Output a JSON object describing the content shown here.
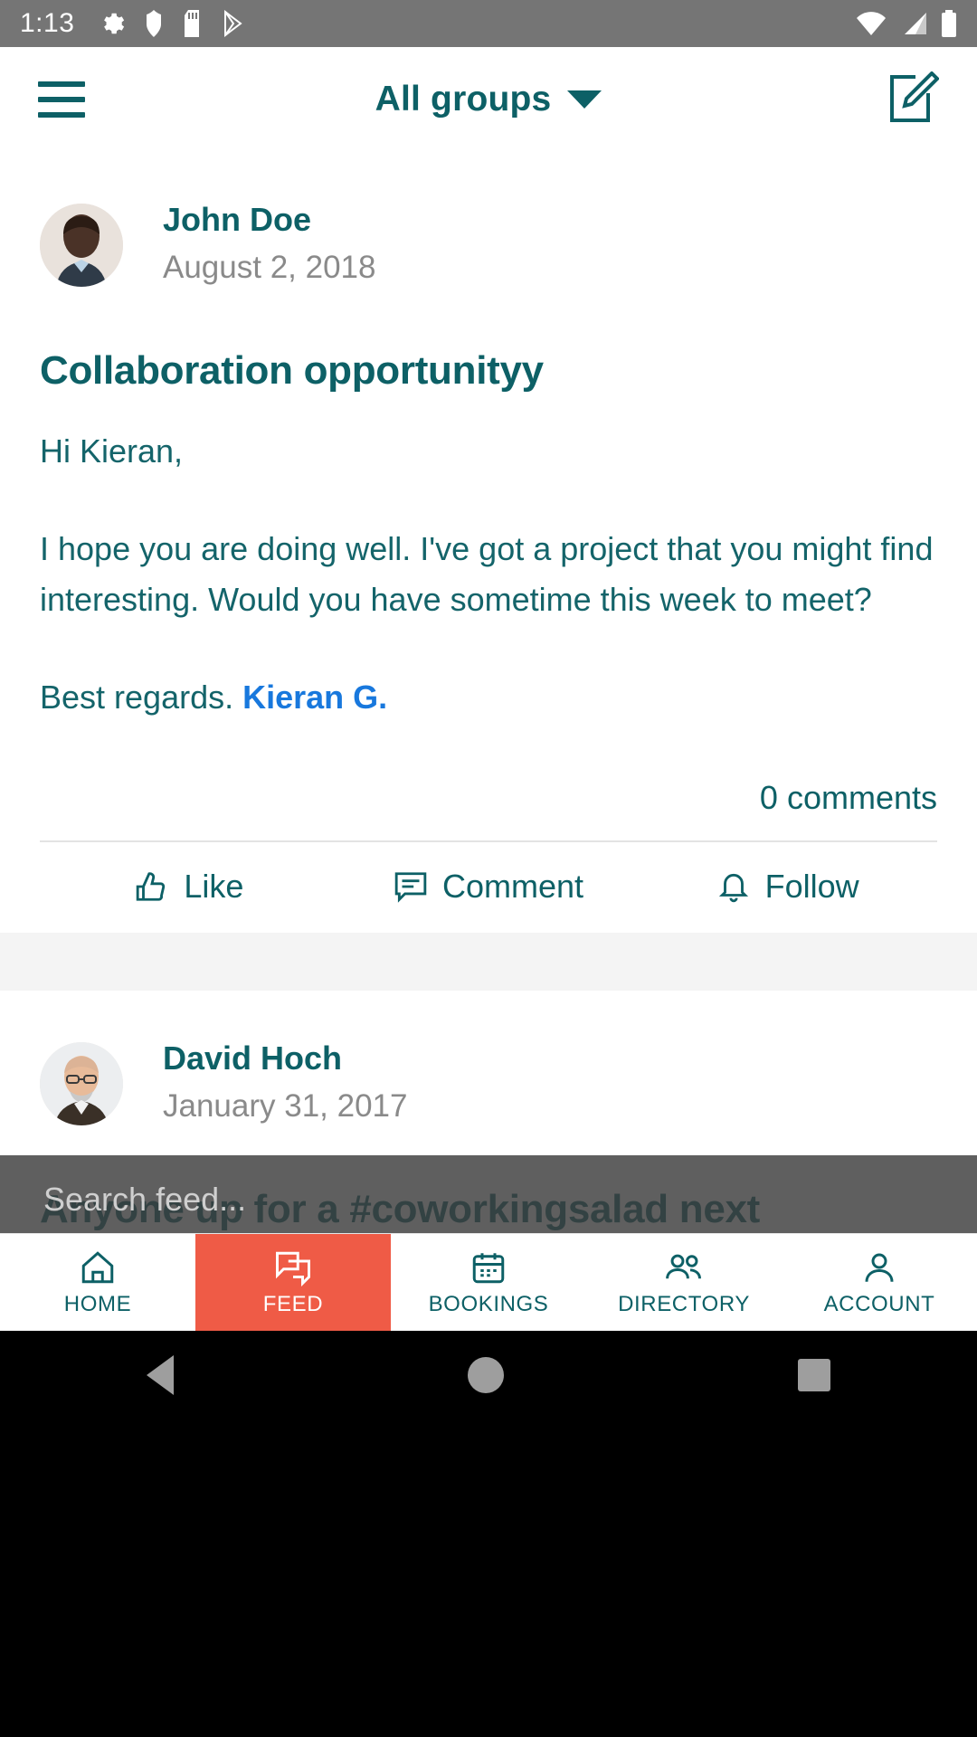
{
  "status_bar": {
    "time": "1:13",
    "left_icons": [
      "settings-gear-icon",
      "shield-icon",
      "sd-card-icon",
      "play-store-icon"
    ],
    "right_icons": [
      "wifi-icon",
      "cellular-signal-icon",
      "battery-icon"
    ]
  },
  "header": {
    "menu_icon": "hamburger-menu-icon",
    "title": "All groups",
    "dropdown_icon": "chevron-down-icon",
    "compose_icon": "compose-icon"
  },
  "posts": [
    {
      "author": "John Doe",
      "date": "August 2, 2018",
      "title": "Collaboration opportunityy",
      "greeting": "Hi Kieran,",
      "paragraph": "I hope you are doing well. I've got a project that you might find interesting. Would you have sometime this week to meet?",
      "signoff_text": "Best regards. ",
      "signoff_mention": "Kieran G.",
      "comment_count": "0 comments",
      "actions": [
        {
          "label": "Like",
          "icon": "thumbs-up-icon"
        },
        {
          "label": "Comment",
          "icon": "comment-bubble-icon"
        },
        {
          "label": "Follow",
          "icon": "bell-icon"
        }
      ]
    },
    {
      "author": "David Hoch",
      "date": "January 31, 2017",
      "title": "Anyone up for a #coworkingsalad next"
    }
  ],
  "search": {
    "placeholder": "Search feed..."
  },
  "bottom_nav": {
    "items": [
      {
        "label": "HOME",
        "icon": "home-icon",
        "active": false
      },
      {
        "label": "FEED",
        "icon": "feed-chat-icon",
        "active": true
      },
      {
        "label": "BOOKINGS",
        "icon": "calendar-icon",
        "active": false
      },
      {
        "label": "DIRECTORY",
        "icon": "people-icon",
        "active": false
      },
      {
        "label": "ACCOUNT",
        "icon": "person-icon",
        "active": false
      }
    ]
  },
  "android_nav": {
    "back": "back-triangle-icon",
    "home": "home-circle-icon",
    "recents": "recents-square-icon"
  },
  "colors": {
    "brand_teal": "#0d6066",
    "body_teal": "#14646a",
    "mention_blue": "#1878dd",
    "active_nav": "#ef5b46",
    "status_bar_gray": "#757575",
    "date_gray": "#8a8a8a"
  }
}
